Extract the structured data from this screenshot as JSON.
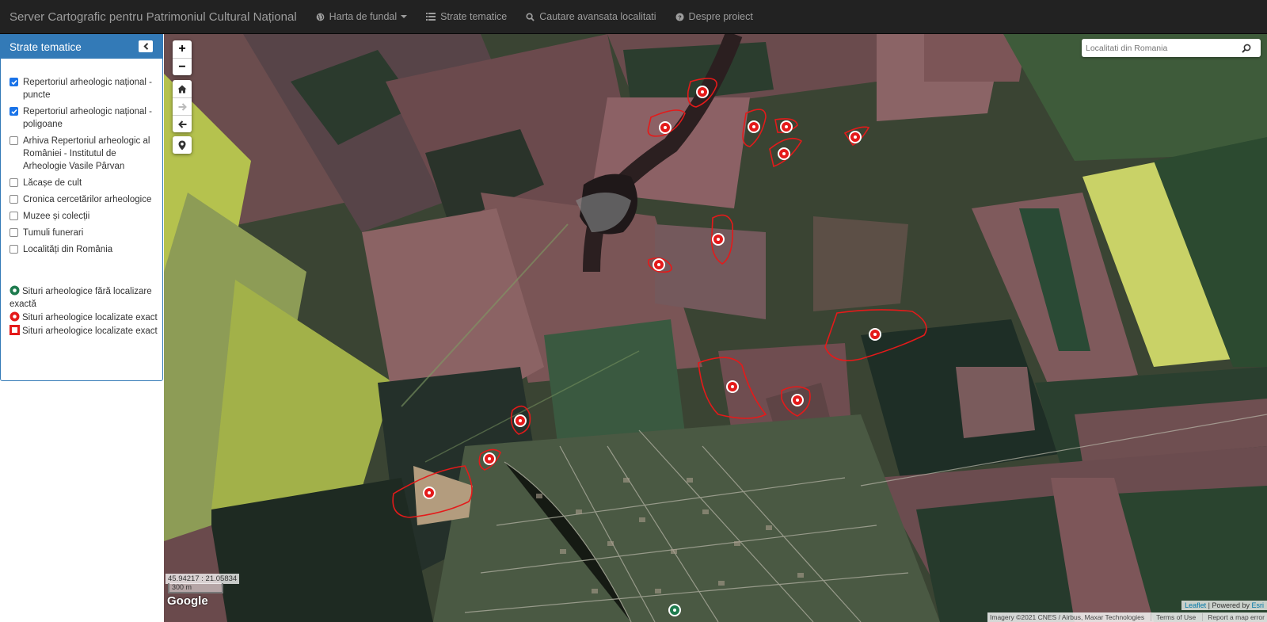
{
  "navbar": {
    "brand": "Server Cartografic pentru Patrimoniul Cultural Național",
    "items": [
      {
        "label": "Harta de fundal",
        "icon": "globe-icon"
      },
      {
        "label": "Strate tematice",
        "icon": "list-icon"
      },
      {
        "label": "Cautare avansata localitati",
        "icon": "search-icon"
      },
      {
        "label": "Despre proiect",
        "icon": "question-circle-icon"
      }
    ]
  },
  "sidebar": {
    "title": "Strate tematice",
    "layers": [
      {
        "label": "Repertoriul arheologic național - puncte",
        "checked": true
      },
      {
        "label": "Repertoriul arheologic național - poligoane",
        "checked": true
      },
      {
        "label": "Arhiva Repertoriul arheologic al României - Institutul de Arheologie Vasile Pârvan",
        "checked": false
      },
      {
        "label": "Lăcașe de cult",
        "checked": false
      },
      {
        "label": "Cronica cercetărilor arheologice",
        "checked": false
      },
      {
        "label": "Muzee și colecții",
        "checked": false
      },
      {
        "label": "Tumuli funerari",
        "checked": false
      },
      {
        "label": "Localități din România",
        "checked": false
      }
    ],
    "legend": [
      {
        "label": "Situri arheologice fără localizare exactă",
        "color": "#1e7b4e",
        "shape": "circle"
      },
      {
        "label": "Situri arheologice localizate exact",
        "color": "#e41a1a",
        "shape": "circle"
      },
      {
        "label": "Situri arheologice localizate exact",
        "color": "#e41a1a",
        "shape": "square"
      }
    ]
  },
  "map": {
    "search_placeholder": "Localitati din Romania",
    "coords": "45.94217 : 21.05834",
    "scale_label": "300 m",
    "google_logo": "Google",
    "attrib_leaflet": "Leaflet",
    "attrib_powered": "Powered by",
    "attrib_esri": "Esri",
    "attrib_imagery": "Imagery ©2021 CNES / Airbus, Maxar Technologies",
    "attrib_terms": "Terms of Use",
    "attrib_report": "Report a map error",
    "marker_color": "#e41a1a"
  }
}
